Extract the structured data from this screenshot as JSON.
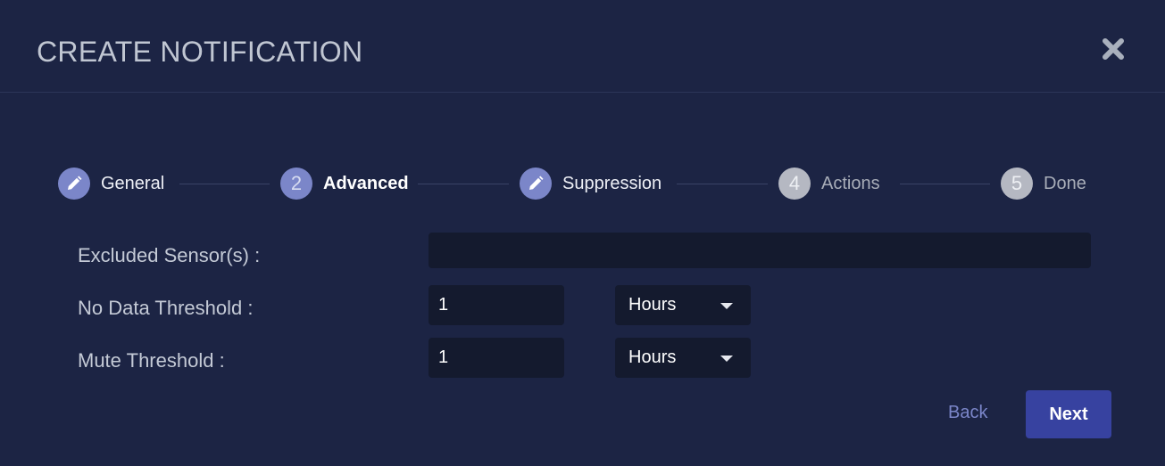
{
  "dialog": {
    "title": "CREATE NOTIFICATION",
    "close_icon": "close-x-icon"
  },
  "stepper": {
    "steps": [
      {
        "label": "General",
        "indicator": "pencil-icon",
        "state": "completed"
      },
      {
        "label": "Advanced",
        "number": "2",
        "state": "active"
      },
      {
        "label": "Suppression",
        "indicator": "pencil-icon",
        "state": "completed"
      },
      {
        "label": "Actions",
        "number": "4",
        "state": "pending"
      },
      {
        "label": "Done",
        "number": "5",
        "state": "pending"
      }
    ]
  },
  "form": {
    "excluded_sensors": {
      "label": "Excluded Sensor(s) :",
      "value": ""
    },
    "no_data_threshold": {
      "label": "No Data Threshold :",
      "value": "1",
      "unit": "Hours"
    },
    "mute_threshold": {
      "label": "Mute Threshold :",
      "value": "1",
      "unit": "Hours"
    }
  },
  "actions": {
    "back_label": "Back",
    "next_label": "Next"
  },
  "colors": {
    "background": "#1c2444",
    "accent": "#7b86c9",
    "primary_button": "#3742a0",
    "input_background": "#141a2e",
    "pending_step": "#b5b8c2"
  }
}
